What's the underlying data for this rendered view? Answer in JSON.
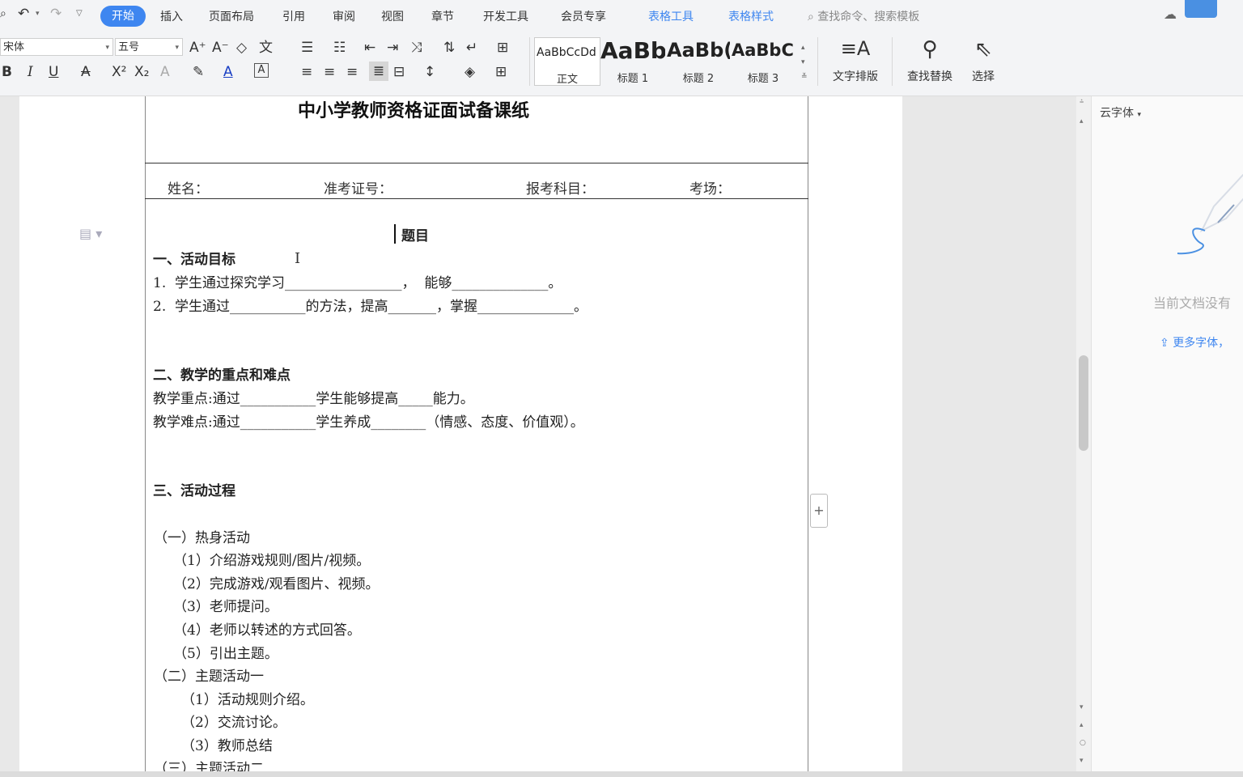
{
  "menubar": {
    "tabs": [
      "开始",
      "插入",
      "页面布局",
      "引用",
      "审阅",
      "视图",
      "章节",
      "开发工具",
      "会员专享",
      "表格工具",
      "表格样式"
    ],
    "active_tab": "开始",
    "search_placeholder": "查找命令、搜索模板"
  },
  "ribbon": {
    "font_name": "宋体",
    "font_size": "五号",
    "styles": [
      {
        "sample": "AaBbCcDd",
        "label": "正文"
      },
      {
        "sample": "AaBb",
        "label": "标题 1"
      },
      {
        "sample": "AaBb(",
        "label": "标题 2"
      },
      {
        "sample": "AaBbC(",
        "label": "标题 3"
      }
    ],
    "text_layout": "文字排版",
    "find_replace": "查找替换",
    "select": "选择"
  },
  "document": {
    "title": "中小学教师资格证面试备课纸",
    "fields": [
      "姓名：",
      "准考证号：",
      "报考科目：",
      "考场："
    ],
    "topic_heading": "题目",
    "section1_title": "一、活动目标",
    "s1_line1": "1.  学生通过探究学习_________________，  能够______________。",
    "s1_line2": "2.  学生通过___________的方法，提高_______，掌握______________。",
    "section2_title": "二、教学的重点和难点",
    "s2_line1": "教学重点:通过___________学生能够提高_____能力。",
    "s2_line2": "教学难点:通过___________学生养成________（情感、态度、价值观）。",
    "section3_title": "三、活动过程",
    "warmup_title": "（一）热身活动",
    "warmup_items": [
      "（1）介绍游戏规则/图片/视频。",
      "（2）完成游戏/观看图片、视频。",
      "（3）老师提问。",
      "（4）老师以转述的方式回答。",
      "（5）引出主题。"
    ],
    "activity1_title": "（二）主题活动一",
    "activity1_items": [
      "（1）活动规则介绍。",
      "（2）交流讨论。",
      "（3）教师总结"
    ],
    "activity2_title": "（三）主题活动二"
  },
  "sidepanel": {
    "title": "云字体",
    "empty_text": "当前文档没有",
    "more_fonts": "更多字体，"
  }
}
